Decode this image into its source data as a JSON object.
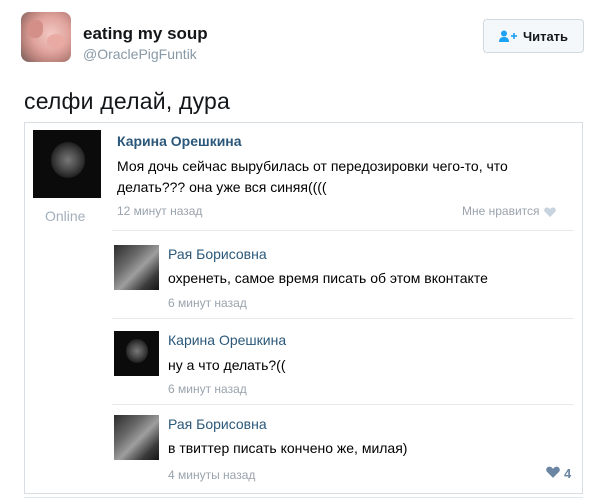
{
  "header": {
    "display_name": "eating my soup",
    "handle": "@OraclePigFuntik",
    "follow_label": "Читать"
  },
  "tweet": {
    "text": "селфи делай, дура"
  },
  "screenshot": {
    "main_comment": {
      "author": "Карина Орешкина",
      "text": "Моя дочь сейчас вырубилась от передозировки чего-то, что делать??? она уже вся синяя((((",
      "status": "Online",
      "time": "12 минут назад",
      "like_label": "Мне нравится"
    },
    "replies": [
      {
        "author": "Рая Борисовна",
        "text": "охренеть, самое время писать об этом вконтакте",
        "time": "6 минут назад"
      },
      {
        "author": "Карина Орешкина",
        "text": "ну а что делать?((",
        "time": "6 минут назад"
      },
      {
        "author": "Рая Борисовна",
        "text": "в твиттер писать кончено же, милая)",
        "time": "4 минуты назад"
      }
    ],
    "like_count": "4"
  },
  "colors": {
    "link_blue": "#2b587a",
    "muted": "#9aa3ad",
    "heart": "#6b86a3"
  },
  "icons": [
    "add-user-icon",
    "heart-icon"
  ]
}
